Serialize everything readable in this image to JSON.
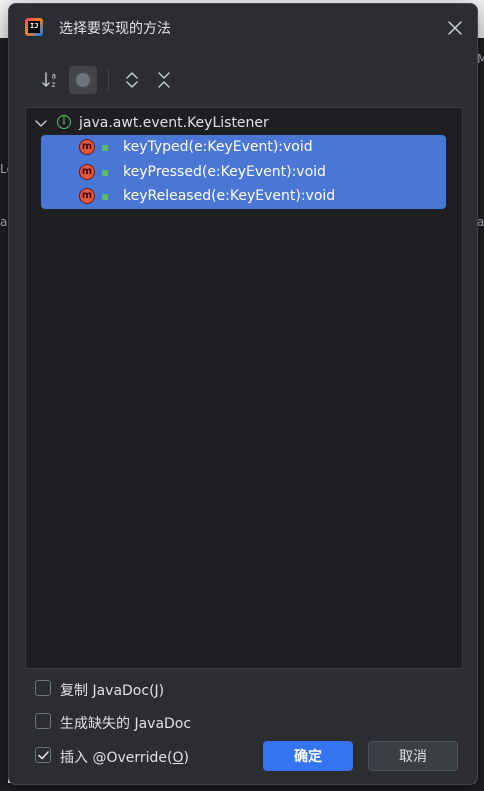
{
  "dialog": {
    "title": "选择要实现的方法",
    "app_icon": "intellij-logo-icon",
    "close_icon": "close-icon"
  },
  "toolbar": {
    "buttons": [
      {
        "icon": "sort-alphabetically-icon",
        "active": false
      },
      {
        "icon": "show-classes-icon",
        "active": true
      },
      {
        "icon": "expand-all-icon",
        "active": false
      },
      {
        "icon": "collapse-all-icon",
        "active": false
      }
    ]
  },
  "tree": {
    "root": {
      "label": "java.awt.event.KeyListener",
      "icon": "interface-icon",
      "expanded": true
    },
    "methods": [
      {
        "label": "keyTyped(e:KeyEvent):void",
        "icon": "method-icon",
        "selected": true
      },
      {
        "label": "keyPressed(e:KeyEvent):void",
        "icon": "method-icon",
        "selected": true
      },
      {
        "label": "keyReleased(e:KeyEvent):void",
        "icon": "method-icon",
        "selected": true
      }
    ]
  },
  "options": {
    "copy_javadoc": {
      "prefix": "复制 JavaDoc(",
      "mnemonic": "J",
      "suffix": ")",
      "checked": false
    },
    "generate_javadoc": {
      "label": "生成缺失的 JavaDoc",
      "checked": false
    },
    "insert_override": {
      "prefix": "插入 @Override(",
      "mnemonic": "O",
      "suffix": ")",
      "checked": true
    }
  },
  "buttons": {
    "ok": "确定",
    "cancel": "取消"
  },
  "colors": {
    "dialog_bg": "#2b2d30",
    "selection": "#4a77d6",
    "primary_button": "#3574f0"
  },
  "background_fragments": {
    "left_top": "Le",
    "left_mid": "a",
    "right_top": "M",
    "right_mid": "a"
  }
}
